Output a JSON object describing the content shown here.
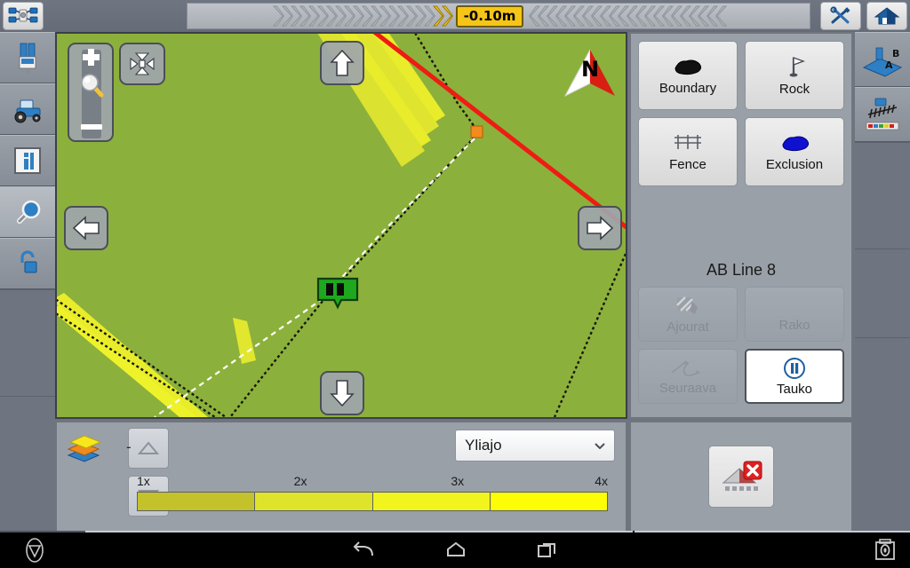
{
  "topbar": {
    "gps_icon": "gps-satellite-icon",
    "tools_icon": "tools-wrench-screwdriver-icon",
    "home_icon": "home-icon",
    "offset_value": "-0.10m",
    "lightbar": {
      "left_chevrons": 20,
      "left_active_chevrons": 2,
      "right_chevrons": 22,
      "right_active_chevrons": 0,
      "active_color": "#f5c518",
      "inactive_color": "#b2b6bd"
    }
  },
  "left_rail": {
    "items": [
      {
        "name": "implement-top-view",
        "icon": "implement-icon"
      },
      {
        "name": "tractor-side-view",
        "icon": "tractor-icon"
      },
      {
        "name": "info-panel",
        "icon": "info-icon"
      },
      {
        "name": "magnifier-zoom",
        "icon": "magnifier-icon"
      },
      {
        "name": "unlock",
        "icon": "padlock-open-icon"
      }
    ]
  },
  "right_rail": {
    "items": [
      {
        "name": "ab-line-setup",
        "icon": "ab-line-icon"
      },
      {
        "name": "implement-coverage",
        "icon": "implement-coverage-icon"
      }
    ]
  },
  "map": {
    "background_color": "#8cb03c",
    "compass_label": "N",
    "guidance_line_color": "#ee1c14",
    "coverage_color": "#edf02a",
    "boundary_color": "#111111",
    "vehicle_marker_color": "#1fa81f",
    "waypoint_color": "#f58a1f",
    "controls": {
      "zoom_in": "+",
      "zoom_out": "-",
      "fit_screen": "fit-to-screen-icon",
      "pan_up": "arrow-up-icon",
      "pan_down": "arrow-down-icon",
      "pan_left": "arrow-left-icon",
      "pan_right": "arrow-right-icon"
    }
  },
  "right_panel": {
    "features": [
      {
        "label": "Boundary",
        "icon": "boundary-blob-icon"
      },
      {
        "label": "Rock",
        "icon": "flag-icon"
      },
      {
        "label": "Fence",
        "icon": "fence-icon"
      },
      {
        "label": "Exclusion",
        "icon": "exclusion-blob-icon"
      }
    ],
    "ab_title": "AB Line 8",
    "ab_buttons": [
      {
        "label": "Ajourat",
        "icon": "tramline-icon",
        "enabled": false
      },
      {
        "label": "Rako",
        "icon": "gap-icon",
        "enabled": false
      },
      {
        "label": "Seuraava",
        "icon": "next-curve-icon",
        "enabled": false
      },
      {
        "label": "Tauko",
        "icon": "pause-icon",
        "enabled": true
      }
    ]
  },
  "bottom_panel": {
    "layers_icon": "layers-icon",
    "up_icon": "triangle-up-icon",
    "down_icon": "triangle-down-icon",
    "value_label": "-",
    "dropdown": {
      "value": "Yliajo",
      "caret": "chevron-down-icon"
    },
    "legend": {
      "labels": [
        "1x",
        "2x",
        "3x",
        "4x"
      ],
      "colors": [
        "#c3c22b",
        "#dfe42b",
        "#f2f41e",
        "#fdfd05"
      ]
    }
  },
  "exit": {
    "icon": "close-coverage-icon"
  },
  "navbar": {
    "vendor_icon": "vendor-logo-icon",
    "back_icon": "back-icon",
    "home_icon": "home-icon",
    "recents_icon": "recents-icon",
    "screenshot_icon": "screenshot-camera-icon"
  }
}
